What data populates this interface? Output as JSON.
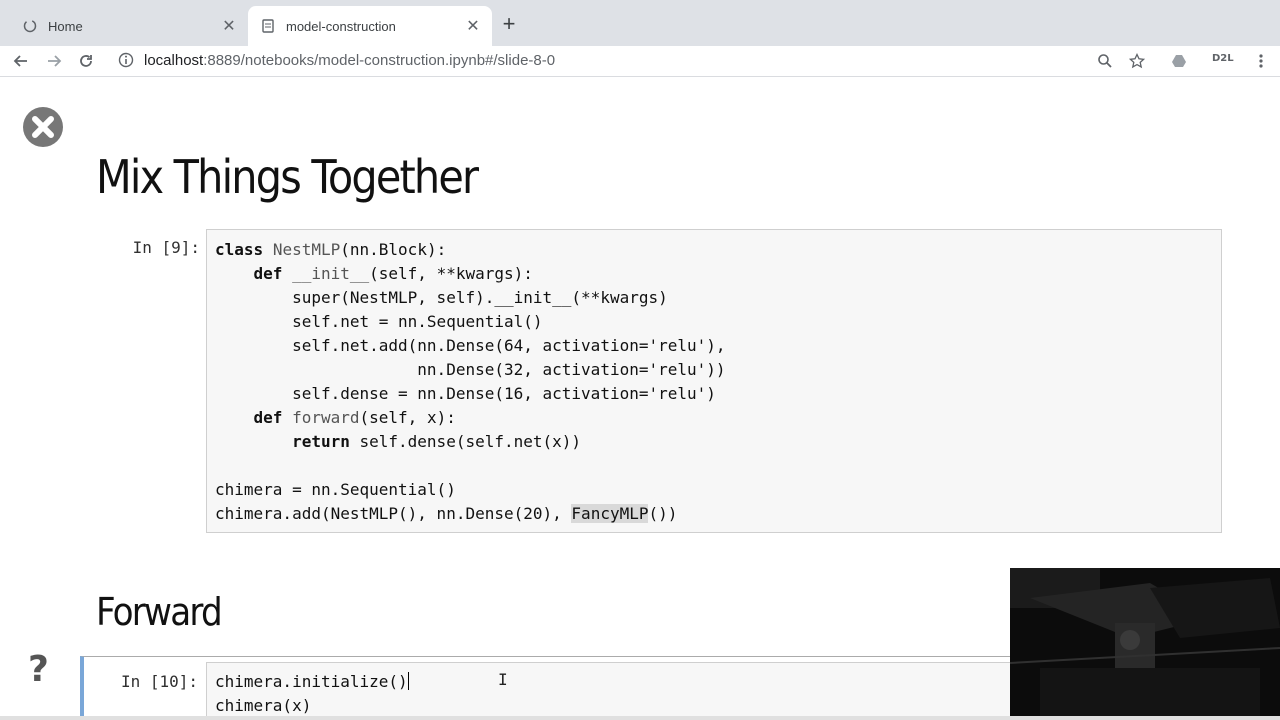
{
  "browser": {
    "tabs": [
      {
        "title": "Home",
        "active": false
      },
      {
        "title": "model-construction",
        "active": true
      }
    ],
    "url_host": "localhost",
    "url_rest": ":8889/notebooks/model-construction.ipynb#/slide-8-0",
    "extension_label": "D2L"
  },
  "slide": {
    "title": "Mix Things Together",
    "section_title": "Forward"
  },
  "cells": [
    {
      "prompt": "In [9]:",
      "lines": [
        "class NestMLP(nn.Block):",
        "    def __init__(self, **kwargs):",
        "        super(NestMLP, self).__init__(**kwargs)",
        "        self.net = nn.Sequential()",
        "        self.net.add(nn.Dense(64, activation='relu'),",
        "                     nn.Dense(32, activation='relu'))",
        "        self.dense = nn.Dense(16, activation='relu')",
        "    def forward(self, x):",
        "        return self.dense(self.net(x))",
        "",
        "chimera = nn.Sequential()",
        "chimera.add(NestMLP(), nn.Dense(20), FancyMLP())"
      ]
    },
    {
      "prompt": "In [10]:",
      "lines": [
        "chimera.initialize()",
        "chimera(x)"
      ]
    }
  ],
  "colors": {
    "active_cell_border": "#7aa7d8",
    "code_background": "#f7f7f7",
    "tab_strip": "#dee1e6"
  }
}
